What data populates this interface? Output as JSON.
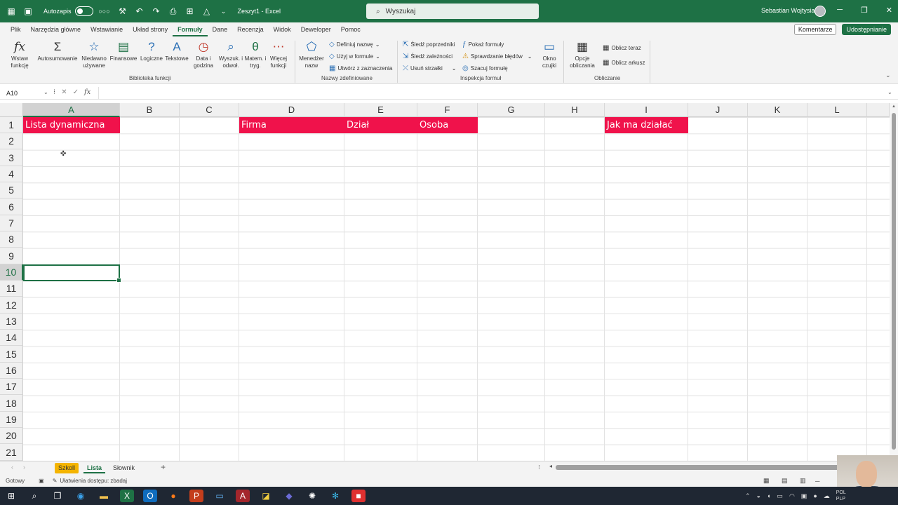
{
  "titlebar": {
    "autosave_label": "Autozapis",
    "filename": "Zeszyt1 - Excel",
    "search_placeholder": "Wyszukaj",
    "user_name": "Sebastian Wojtysiak"
  },
  "menu": {
    "tabs": [
      "Plik",
      "Narzędzia główne",
      "Wstawianie",
      "Układ strony",
      "Formuły",
      "Dane",
      "Recenzja",
      "Widok",
      "Deweloper",
      "Pomoc"
    ],
    "comments": "Komentarze",
    "share": "Udostępnianie"
  },
  "ribbon": {
    "insert_function": "Wstaw funkcję",
    "autosum": "Autosumowanie",
    "recent": "Niedawno używane",
    "financial": "Finansowe",
    "logical": "Logiczne",
    "text": "Tekstowe",
    "datetime": "Data i godzina",
    "lookup": "Wyszuk. i odwoł.",
    "math": "Matem. i tryg.",
    "more": "Więcej funkcji",
    "name_manager": "Menedżer nazw",
    "define_name": "Definiuj nazwę",
    "use_in_formula": "Użyj w formule",
    "create_from_selection": "Utwórz z zaznaczenia",
    "trace_precedents": "Śledź poprzedniki",
    "trace_dependents": "Śledź zależności",
    "remove_arrows": "Usuń strzałki",
    "show_formulas": "Pokaż formuły",
    "error_checking": "Sprawdzanie błędów",
    "evaluate_formula": "Szacuj formułę",
    "watch_window": "Okno czujki",
    "calc_options": "Opcje obliczania",
    "calc_now": "Oblicz teraz",
    "calc_sheet": "Oblicz arkusz",
    "group_library": "Biblioteka funkcji",
    "group_names": "Nazwy zdefiniowane",
    "group_audit": "Inspekcja formuł",
    "group_calc": "Obliczanie"
  },
  "formula_bar": {
    "name_box": "A10",
    "fx": "fx",
    "content": ""
  },
  "columns": [
    "A",
    "B",
    "C",
    "D",
    "E",
    "F",
    "G",
    "H",
    "I",
    "J",
    "K",
    "L"
  ],
  "rows": [
    "1",
    "2",
    "3",
    "4",
    "5",
    "6",
    "7",
    "8",
    "9",
    "10",
    "11",
    "12",
    "13",
    "14",
    "15",
    "16",
    "17",
    "18",
    "19",
    "20",
    "21"
  ],
  "cells": {
    "A1": "Lista dynamiczna",
    "D1": "Firma",
    "E1": "Dział",
    "F1": "Osoba",
    "I1": "Jak ma działać"
  },
  "colors": {
    "accent": "#1e7145",
    "header_fill": "#f0124b",
    "sheet_tab_szkoll": "#f4b400"
  },
  "sheets": [
    "Szkoll",
    "Lista",
    "Słownik"
  ],
  "active_sheet": "Lista",
  "status": {
    "ready": "Gotowy",
    "accessibility": "Ułatwienia dostępu: zbadaj"
  },
  "tray": {
    "lang_top": "POL",
    "lang_bottom": "PLP"
  }
}
